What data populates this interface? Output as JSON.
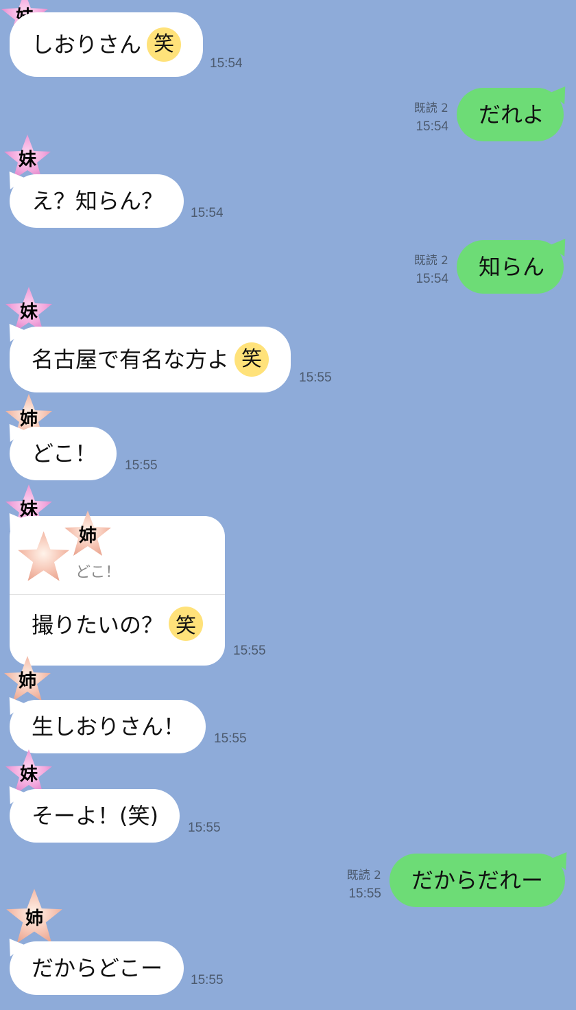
{
  "avatars": {
    "imouto": "妹",
    "ane": "姉"
  },
  "read_label": "既読 2",
  "emoji_warai": "笑",
  "messages": [
    {
      "text": "しおりさん",
      "time": "15:54"
    },
    {
      "text": "だれよ",
      "time": "15:54"
    },
    {
      "text": "え？知らん？",
      "time": "15:54"
    },
    {
      "text": "知らん",
      "time": "15:54"
    },
    {
      "text": "名古屋で有名な方よ",
      "time": "15:55"
    },
    {
      "text": "どこ！",
      "time": "15:55"
    },
    {
      "quote": "どこ！",
      "text": "撮りたいの？",
      "time": "15:55"
    },
    {
      "text": "生しおりさん！",
      "time": "15:55"
    },
    {
      "text": "そーよ！(笑)",
      "time": "15:55"
    },
    {
      "text": "だからだれー",
      "time": "15:55"
    },
    {
      "text": "だからどこー",
      "time": "15:55"
    }
  ],
  "colors": {
    "background": "#8eabd9",
    "incoming": "#ffffff",
    "outgoing": "#6ddc76",
    "imouto_star": "#f2a6dc",
    "ane_star": "#f6c4b3"
  }
}
